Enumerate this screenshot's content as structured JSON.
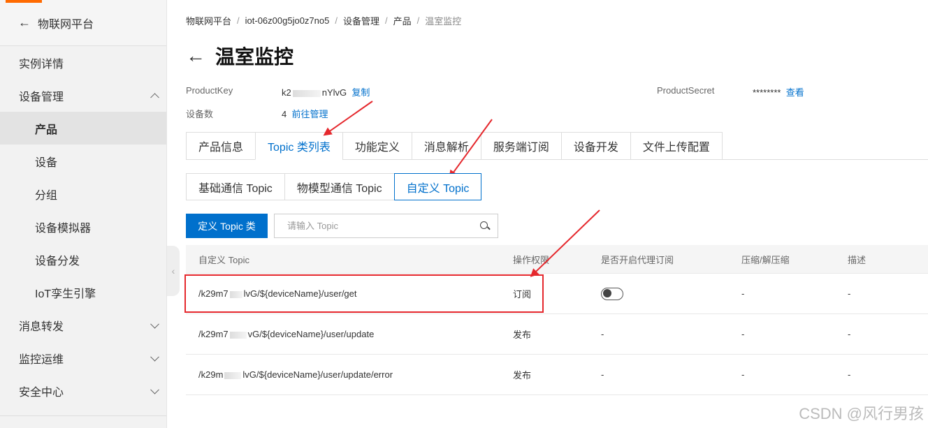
{
  "sidebar": {
    "header": "物联网平台",
    "items": [
      {
        "label": "实例详情"
      },
      {
        "label": "设备管理"
      },
      {
        "label": "产品"
      },
      {
        "label": "设备"
      },
      {
        "label": "分组"
      },
      {
        "label": "设备模拟器"
      },
      {
        "label": "设备分发"
      },
      {
        "label": "IoT孪生引擎"
      },
      {
        "label": "消息转发"
      },
      {
        "label": "监控运维"
      },
      {
        "label": "安全中心"
      }
    ]
  },
  "breadcrumb": [
    "物联网平台",
    "iot-06z00g5jo0z7no5",
    "设备管理",
    "产品",
    "温室监控"
  ],
  "page_title": "温室监控",
  "info": {
    "product_key_label": "ProductKey",
    "product_key_prefix": "k2",
    "product_key_suffix": "nYlvG",
    "copy_label": "复制",
    "device_count_label": "设备数",
    "device_count": "4",
    "manage_label": "前往管理",
    "product_secret_label": "ProductSecret",
    "product_secret_value": "********",
    "view_label": "查看"
  },
  "tabs": [
    "产品信息",
    "Topic 类列表",
    "功能定义",
    "消息解析",
    "服务端订阅",
    "设备开发",
    "文件上传配置"
  ],
  "subtabs": [
    "基础通信 Topic",
    "物模型通信 Topic",
    "自定义 Topic"
  ],
  "toolbar": {
    "define_button": "定义 Topic 类",
    "search_placeholder": "请输入 Topic"
  },
  "table": {
    "headers": [
      "自定义 Topic",
      "操作权限",
      "是否开启代理订阅",
      "压缩/解压缩",
      "描述"
    ],
    "rows": [
      {
        "topic_prefix": "/k29m7",
        "topic_suffix": "lvG/${deviceName}/user/get",
        "permission": "订阅",
        "proxy": "",
        "compress": "-",
        "desc": "-"
      },
      {
        "topic_prefix": "/k29m7",
        "topic_suffix": "vG/${deviceName}/user/update",
        "permission": "发布",
        "proxy": "-",
        "compress": "-",
        "desc": "-"
      },
      {
        "topic_prefix": "/k29m",
        "topic_suffix": "lvG/${deviceName}/user/update/error",
        "permission": "发布",
        "proxy": "-",
        "compress": "-",
        "desc": "-"
      }
    ]
  },
  "watermark": "CSDN @风行男孩",
  "colors": {
    "accent": "#0070cc",
    "annotation": "#e5282d",
    "brand": "#ff6a00"
  }
}
